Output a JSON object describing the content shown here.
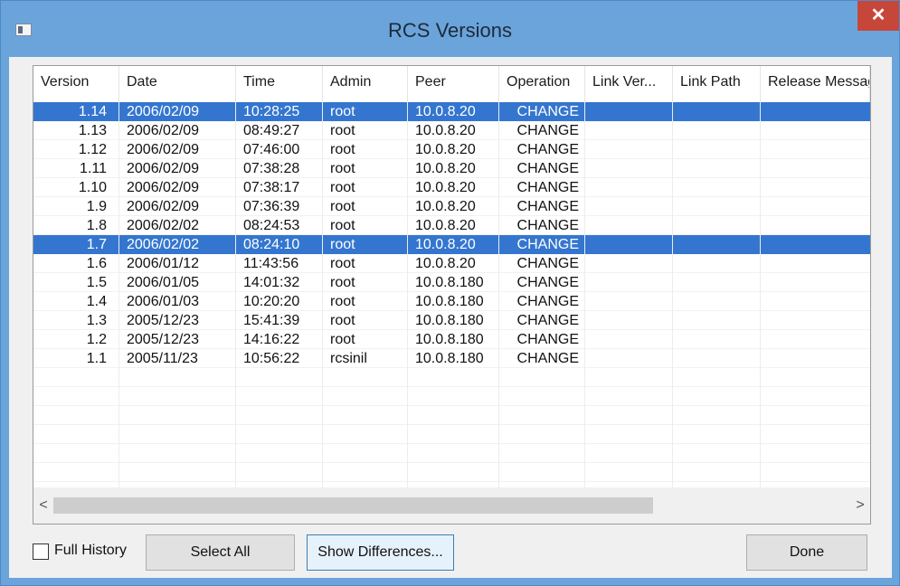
{
  "window": {
    "title": "RCS Versions",
    "close_glyph": "✕"
  },
  "table": {
    "columns": [
      "Version",
      "Date",
      "Time",
      "Admin",
      "Peer",
      "Operation",
      "Link Ver...",
      "Link Path",
      "Release Message"
    ],
    "rows": [
      {
        "version": "1.14",
        "date": "2006/02/09",
        "time": "10:28:25",
        "admin": "root",
        "peer": "10.0.8.20",
        "operation": "CHANGE",
        "link_ver": "",
        "link_path": "",
        "release_message": "",
        "selected": true
      },
      {
        "version": "1.13",
        "date": "2006/02/09",
        "time": "08:49:27",
        "admin": "root",
        "peer": "10.0.8.20",
        "operation": "CHANGE",
        "link_ver": "",
        "link_path": "",
        "release_message": "",
        "selected": false
      },
      {
        "version": "1.12",
        "date": "2006/02/09",
        "time": "07:46:00",
        "admin": "root",
        "peer": "10.0.8.20",
        "operation": "CHANGE",
        "link_ver": "",
        "link_path": "",
        "release_message": "",
        "selected": false
      },
      {
        "version": "1.11",
        "date": "2006/02/09",
        "time": "07:38:28",
        "admin": "root",
        "peer": "10.0.8.20",
        "operation": "CHANGE",
        "link_ver": "",
        "link_path": "",
        "release_message": "",
        "selected": false
      },
      {
        "version": "1.10",
        "date": "2006/02/09",
        "time": "07:38:17",
        "admin": "root",
        "peer": "10.0.8.20",
        "operation": "CHANGE",
        "link_ver": "",
        "link_path": "",
        "release_message": "",
        "selected": false
      },
      {
        "version": "1.9",
        "date": "2006/02/09",
        "time": "07:36:39",
        "admin": "root",
        "peer": "10.0.8.20",
        "operation": "CHANGE",
        "link_ver": "",
        "link_path": "",
        "release_message": "",
        "selected": false
      },
      {
        "version": "1.8",
        "date": "2006/02/02",
        "time": "08:24:53",
        "admin": "root",
        "peer": "10.0.8.20",
        "operation": "CHANGE",
        "link_ver": "",
        "link_path": "",
        "release_message": "",
        "selected": false
      },
      {
        "version": "1.7",
        "date": "2006/02/02",
        "time": "08:24:10",
        "admin": "root",
        "peer": "10.0.8.20",
        "operation": "CHANGE",
        "link_ver": "",
        "link_path": "",
        "release_message": "",
        "selected": true
      },
      {
        "version": "1.6",
        "date": "2006/01/12",
        "time": "11:43:56",
        "admin": "root",
        "peer": "10.0.8.20",
        "operation": "CHANGE",
        "link_ver": "",
        "link_path": "",
        "release_message": "",
        "selected": false
      },
      {
        "version": "1.5",
        "date": "2006/01/05",
        "time": "14:01:32",
        "admin": "root",
        "peer": "10.0.8.180",
        "operation": "CHANGE",
        "link_ver": "",
        "link_path": "",
        "release_message": "",
        "selected": false
      },
      {
        "version": "1.4",
        "date": "2006/01/03",
        "time": "10:20:20",
        "admin": "root",
        "peer": "10.0.8.180",
        "operation": "CHANGE",
        "link_ver": "",
        "link_path": "",
        "release_message": "",
        "selected": false
      },
      {
        "version": "1.3",
        "date": "2005/12/23",
        "time": "15:41:39",
        "admin": "root",
        "peer": "10.0.8.180",
        "operation": "CHANGE",
        "link_ver": "",
        "link_path": "",
        "release_message": "",
        "selected": false
      },
      {
        "version": "1.2",
        "date": "2005/12/23",
        "time": "14:16:22",
        "admin": "root",
        "peer": "10.0.8.180",
        "operation": "CHANGE",
        "link_ver": "",
        "link_path": "",
        "release_message": "",
        "selected": false
      },
      {
        "version": "1.1",
        "date": "2005/11/23",
        "time": "10:56:22",
        "admin": "rcsinil",
        "peer": "10.0.8.180",
        "operation": "CHANGE",
        "link_ver": "",
        "link_path": "",
        "release_message": "",
        "selected": false
      }
    ]
  },
  "scrollbar": {
    "left_arrow": "<",
    "right_arrow": ">"
  },
  "footer": {
    "full_history_label": "Full History",
    "full_history_checked": false,
    "select_all_label": "Select All",
    "show_differences_label": "Show Differences...",
    "done_label": "Done"
  },
  "colors": {
    "title_bar": "#6ba4db",
    "selection": "#3476cf",
    "close_button": "#c7463a"
  }
}
